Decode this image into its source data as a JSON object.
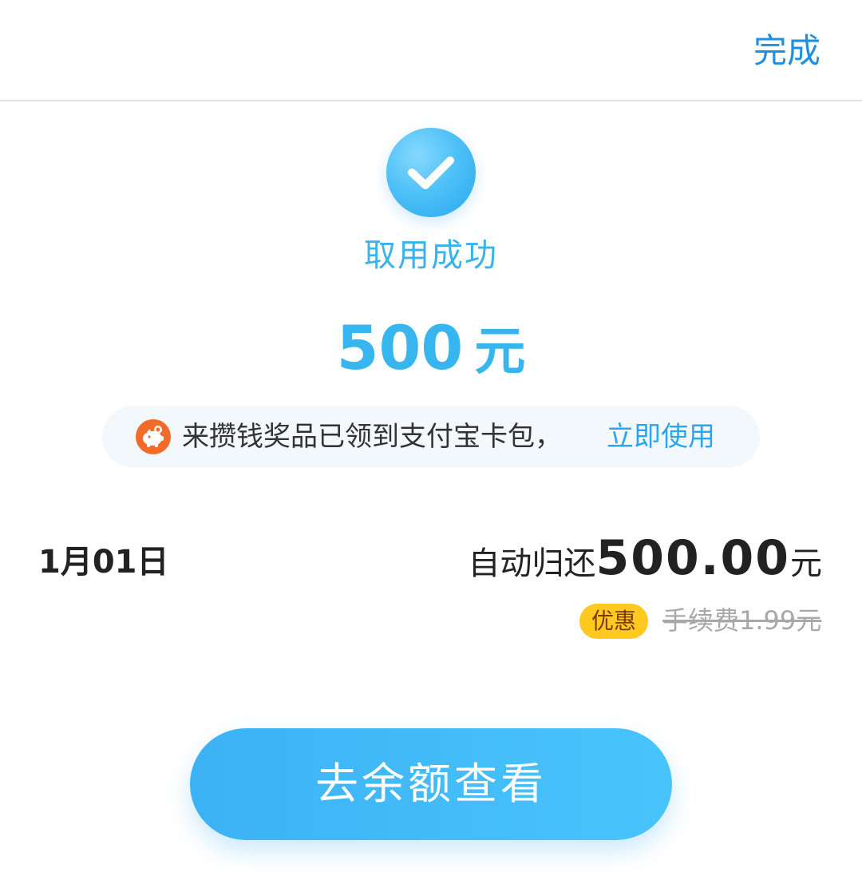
{
  "header": {
    "done_label": "完成"
  },
  "status": {
    "icon": "check-icon",
    "title": "取用成功"
  },
  "amount": {
    "value": "500",
    "unit": "元"
  },
  "notice": {
    "icon": "piggy-bank-icon",
    "text": "来攒钱奖品已领到支付宝卡包，",
    "link_label": "立即使用"
  },
  "repayment": {
    "date": "1月01日",
    "label": "自动归还",
    "amount": "500.00",
    "unit": "元"
  },
  "fee": {
    "discount_label": "优惠",
    "original_fee": "手续费1.99元"
  },
  "actions": {
    "balance_button_label": "去余额查看"
  },
  "colors": {
    "accent": "#37b5ee",
    "link": "#1f8fe0",
    "discount_badge": "#ffc91f",
    "piggy_icon": "#f26b2a"
  }
}
